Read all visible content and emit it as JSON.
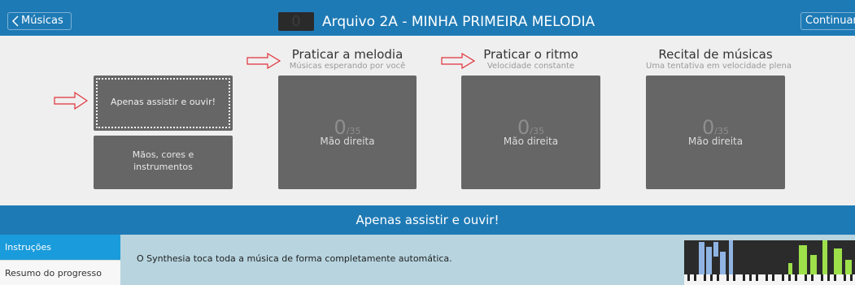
{
  "topbar": {
    "back_label": "Músicas",
    "counter": "0",
    "title": "Arquivo 2A - MINHA PRIMEIRA MELODIA",
    "continue_label": "Continuar"
  },
  "modes": {
    "watch": {
      "label": "Apenas assistir e ouvir!"
    },
    "hands": {
      "label": "Mãos, cores e instrumentos"
    },
    "melody": {
      "title": "Praticar a melodia",
      "subtitle": "Músicas esperando por você",
      "score": "0",
      "total": "/35",
      "hand": "Mão direita"
    },
    "rhythm": {
      "title": "Praticar o ritmo",
      "subtitle": "Velocidade constante",
      "score": "0",
      "total": "/35",
      "hand": "Mão direita"
    },
    "recital": {
      "title": "Recital de músicas",
      "subtitle": "Uma tentativa em velocidade plena",
      "score": "0",
      "total": "/35",
      "hand": "Mão direita"
    }
  },
  "section": {
    "title": "Apenas assistir e ouvir!"
  },
  "sidebar": {
    "items": [
      {
        "label": "Instruções",
        "active": true
      },
      {
        "label": "Resumo do progresso",
        "active": false
      }
    ]
  },
  "content": {
    "text": "O Synthesia toca toda a música de forma completamente automática."
  },
  "colors": {
    "accent": "#1e7ab5",
    "sidebar_active": "#1a9bdb",
    "card": "#666666",
    "content_bg": "#b7d4df",
    "arrow": "#e0323a",
    "preview_blue": "#8fb4e3",
    "preview_green": "#9de04a"
  },
  "icons": [
    "chevron-left-icon",
    "arrow-right-icon"
  ]
}
